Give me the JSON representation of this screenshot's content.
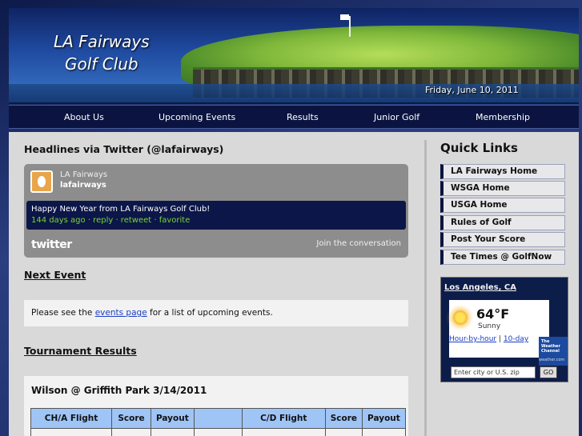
{
  "header": {
    "logo_line1": "LA Fairways",
    "logo_line2": "Golf Club",
    "date": "Friday, June 10, 2011"
  },
  "nav": [
    "About Us",
    "Upcoming Events",
    "Results",
    "Junior Golf",
    "Membership"
  ],
  "twitter": {
    "heading": "Headlines via Twitter (@lafairways)",
    "account_name": "LA Fairways",
    "handle": "lafairways",
    "tweet": "Happy New Year from LA Fairways Golf Club!",
    "meta": "144 days ago · reply · retweet · favorite",
    "brand": "twitter",
    "join": "Join the conversation"
  },
  "next_event": {
    "heading": "Next Event",
    "text_before": "Please see the ",
    "link": "events page",
    "text_after": " for a list of upcoming events."
  },
  "results": {
    "heading": "Tournament Results",
    "title": "Wilson @ Griffith Park 3/14/2011",
    "columns": [
      "CH/A Flight",
      "Score",
      "Payout",
      "",
      "C/D Flight",
      "Score",
      "Payout"
    ]
  },
  "quick_links": {
    "title": "Quick Links",
    "items": [
      "LA Fairways Home",
      "WSGA Home",
      "USGA Home",
      "Rules of Golf",
      "Post Your Score",
      "Tee Times @ GolfNow"
    ]
  },
  "weather": {
    "city": "Los Angeles, CA",
    "temp": "64°F",
    "condition": "Sunny",
    "link_hourly": "Hour-by-hour",
    "separator": "|",
    "link_10day": "10-day",
    "badge": "The Weather Channel",
    "site": "weather.com",
    "zip_placeholder": "Enter city or U.S. zip",
    "go": "GO"
  }
}
